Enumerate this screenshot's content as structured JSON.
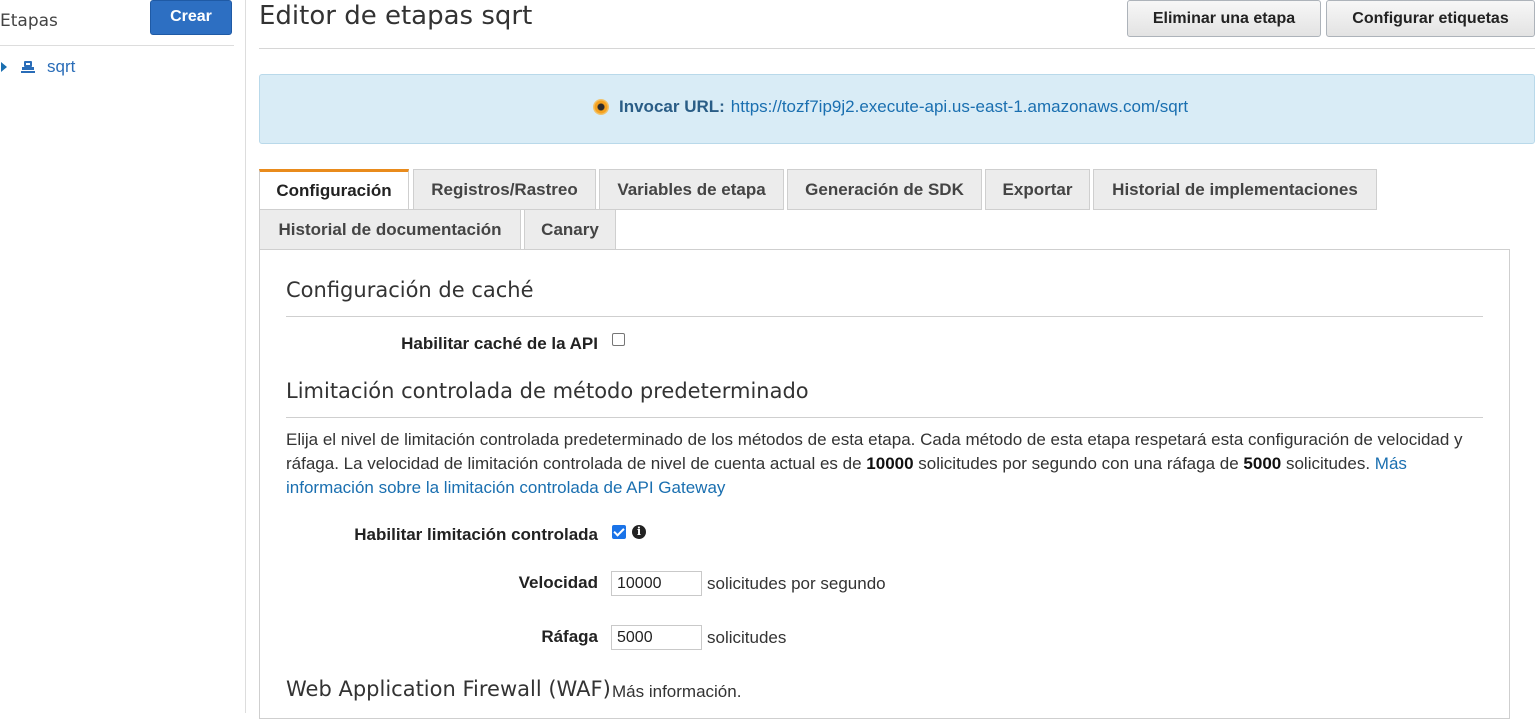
{
  "sidebar": {
    "title": "Etapas",
    "create_label": "Crear",
    "items": [
      {
        "label": "sqrt"
      }
    ]
  },
  "header": {
    "title": "Editor de etapas sqrt",
    "delete_label": "Eliminar una etapa",
    "tags_label": "Configurar etiquetas"
  },
  "banner": {
    "label": "Invocar URL:",
    "url": "https://tozf7ip9j2.execute-api.us-east-1.amazonaws.com/sqrt"
  },
  "tabs": [
    "Configuración",
    "Registros/Rastreo",
    "Variables de etapa",
    "Generación de SDK",
    "Exportar",
    "Historial de implementaciones",
    "Historial de documentación",
    "Canary"
  ],
  "cache": {
    "title": "Configuración de caché",
    "enable_label": "Habilitar caché de la API",
    "enabled": false
  },
  "throttling": {
    "title": "Limitación controlada de método predeterminado",
    "desc_1": "Elija el nivel de limitación controlada predeterminado de los métodos de esta etapa. Cada método de esta etapa respetará esta configuración de velocidad y ráfaga. La velocidad de limitación controlada de nivel de cuenta actual es de ",
    "desc_rate": "10000",
    "desc_2": " solicitudes por segundo con una ráfaga de ",
    "desc_burst": "5000",
    "desc_3": " solicitudes. ",
    "desc_link": "Más información sobre la limitación controlada de API Gateway",
    "enable_label": "Habilitar limitación controlada",
    "enabled": true,
    "rate_label": "Velocidad",
    "rate_value": "10000",
    "rate_unit": "solicitudes por segundo",
    "burst_label": "Ráfaga",
    "burst_value": "5000",
    "burst_unit": "solicitudes"
  },
  "waf": {
    "title": "Web Application Firewall (WAF)",
    "link": "Más información."
  }
}
